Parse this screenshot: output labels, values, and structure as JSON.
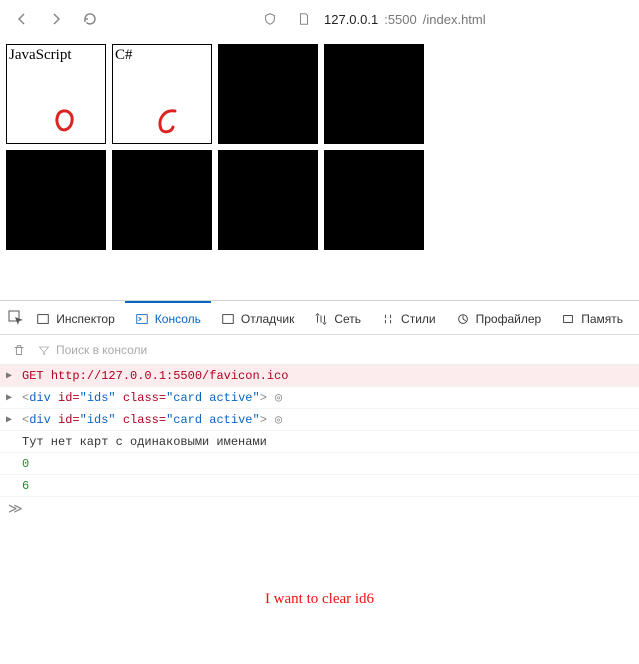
{
  "browser": {
    "url_host": "127.0.0.1",
    "url_port": ":5500",
    "url_path": "/index.html"
  },
  "cards": [
    {
      "label": "JavaScript",
      "active": true,
      "scribble": "zero"
    },
    {
      "label": "C#",
      "active": true,
      "scribble": "six"
    },
    {
      "label": "",
      "active": false
    },
    {
      "label": "",
      "active": false
    },
    {
      "label": "",
      "active": false
    },
    {
      "label": "",
      "active": false
    },
    {
      "label": "",
      "active": false
    },
    {
      "label": "",
      "active": false
    }
  ],
  "devtools": {
    "tabs": {
      "inspector": "Инспектор",
      "console": "Консоль",
      "debugger": "Отладчик",
      "network": "Сеть",
      "styles": "Стили",
      "profiler": "Профайлер",
      "memory": "Память"
    },
    "search_placeholder": "Поиск в консоли",
    "log": {
      "req_method": "GET ",
      "req_url": "http://127.0.0.1:5500/favicon.ico",
      "div_open": "<",
      "div_tag": "div",
      "div_id_attr": " id=",
      "div_id_val": "\"ids\"",
      "div_class_attr": " class=",
      "div_class_val": "\"card active\"",
      "div_close": ">",
      "msg": "Тут нет карт с одинаковыми именами",
      "val1": "0",
      "val2": "6",
      "prompt": "≫"
    }
  },
  "annotation": "I want to clear id6"
}
